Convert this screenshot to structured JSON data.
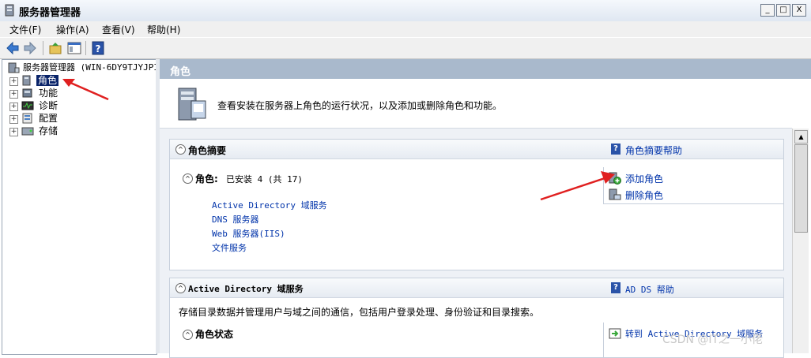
{
  "window": {
    "title": "服务器管理器",
    "min": "_",
    "max": "□",
    "close": "X"
  },
  "menu": [
    "文件(F)",
    "操作(A)",
    "查看(V)",
    "帮助(H)"
  ],
  "tree": {
    "root": "服务器管理器 (WIN-6DY9TJYJPI",
    "items": [
      "角色",
      "功能",
      "诊断",
      "配置",
      "存储"
    ]
  },
  "right_header": "角色",
  "intro_text": "查看安装在服务器上角色的运行状况，以及添加或删除角色和功能。",
  "summary": {
    "title": "角色摘要",
    "help": "角色摘要帮助",
    "roles_label": "角色:",
    "roles_count": "已安装 4 (共 17)",
    "roles": [
      "Active Directory 域服务",
      "DNS 服务器",
      "Web 服务器(IIS)",
      "文件服务"
    ],
    "add_role": "添加角色",
    "remove_role": "删除角色"
  },
  "adds": {
    "title": "Active Directory 域服务",
    "help": "AD DS 帮助",
    "desc": "存储目录数据并管理用户与域之间的通信，包括用户登录处理、身份验证和目录搜索。",
    "status_label": "角色状态",
    "goto": "转到 Active Directory 域服务"
  },
  "watermark": "CSDN @IT之一小佬",
  "colors": {
    "accent": "#0a246a",
    "header": "#a9b9cc",
    "link": "#0033aa",
    "annotation": "#e02020"
  }
}
